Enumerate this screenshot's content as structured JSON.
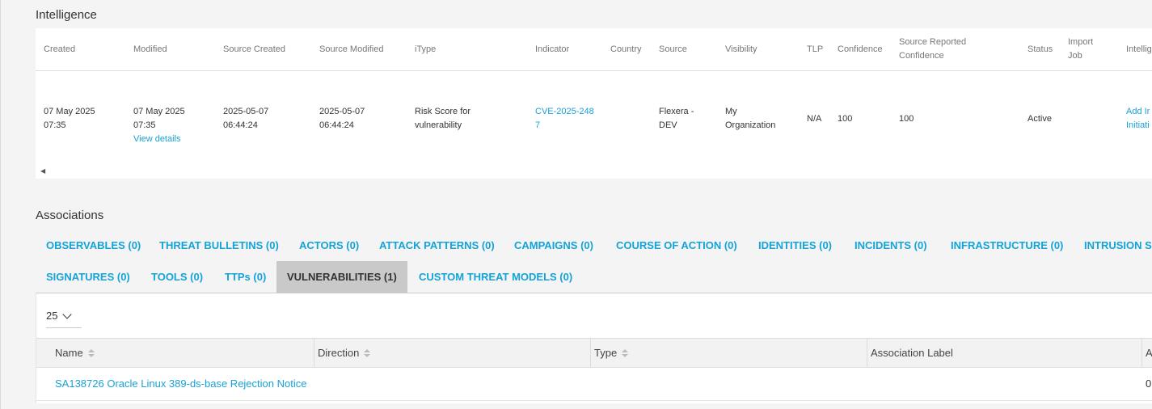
{
  "intelligence": {
    "title": "Intelligence",
    "headers": {
      "created": "Created",
      "modified": "Modified",
      "source_created": "Source Created",
      "source_modified": "Source Modified",
      "itype": "iType",
      "indicator": "Indicator",
      "country": "Country",
      "source": "Source",
      "visibility": "Visibility",
      "tlp": "TLP",
      "confidence": "Confidence",
      "src_conf_1": "Source Reported",
      "src_conf_2": "Confidence",
      "status": "Status",
      "import_1": "Import",
      "import_2": "Job",
      "intelligence": "Intellig"
    },
    "row": {
      "created_1": "07 May 2025",
      "created_2": "07:35",
      "modified_1": "07 May 2025",
      "modified_2": "07:35",
      "view_details": "View details",
      "source_created_1": "2025-05-07",
      "source_created_2": "06:44:24",
      "source_modified_1": "2025-05-07",
      "source_modified_2": "06:44:24",
      "itype_1": "Risk Score for",
      "itype_2": "vulnerability",
      "indicator_1": "CVE-2025-248",
      "indicator_2": "7",
      "source_1": "Flexera -",
      "source_2": "DEV",
      "visibility_1": "My",
      "visibility_2": "Organization",
      "tlp": "N/A",
      "confidence": "100",
      "source_conf": "100",
      "status": "Active",
      "intel_1": "Add Ir",
      "intel_2": "Initiati"
    }
  },
  "associations": {
    "title": "Associations",
    "tabs_row1": [
      "OBSERVABLES (0)",
      "THREAT BULLETINS (0)",
      "ACTORS (0)",
      "ATTACK PATTERNS (0)",
      "CAMPAIGNS (0)",
      "COURSE OF ACTION (0)",
      "IDENTITIES (0)",
      "INCIDENTS (0)",
      "INFRASTRUCTURE (0)",
      "INTRUSION S"
    ],
    "tabs_row2": [
      "SIGNATURES (0)",
      "TOOLS (0)",
      "TTPs (0)",
      "VULNERABILITIES (1)",
      "CUSTOM THREAT MODELS (0)"
    ],
    "active_tab": "VULNERABILITIES (1)",
    "page_size": "25",
    "columns": [
      "Name",
      "Direction",
      "Type",
      "Association Label",
      "A"
    ],
    "rows": [
      {
        "name": "SA138726 Oracle Linux 389-ds-base Rejection Notice",
        "extra": "0"
      }
    ]
  },
  "colors": {
    "link": "#1aa1d6",
    "tab": "#13a3d9",
    "active_tab_bg": "#c9c9c9"
  }
}
